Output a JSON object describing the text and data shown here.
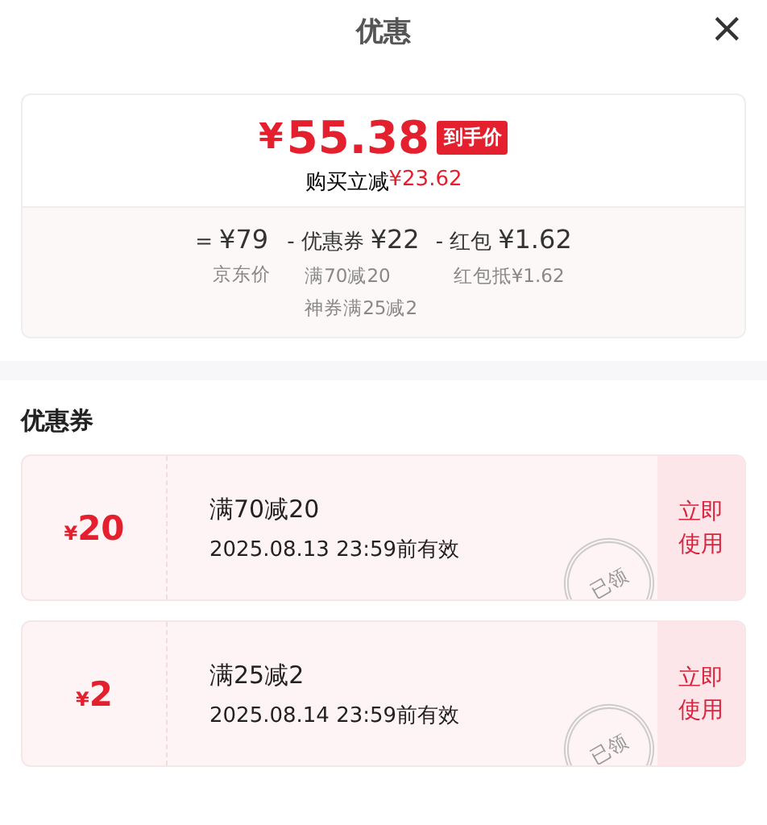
{
  "header": {
    "title": "优惠",
    "close": "×"
  },
  "summary": {
    "currency": "¥",
    "price": "55.38",
    "badge": "到手价",
    "saving_label": "购买立减",
    "saving_amount": "¥23.62",
    "breakdown": [
      {
        "operator": "=",
        "amount": "¥79",
        "notes": [
          "京东价"
        ]
      },
      {
        "operator": "-",
        "label": "优惠券",
        "amount": "¥22",
        "notes": [
          "满70减20",
          "神券满25减2"
        ]
      },
      {
        "operator": "-",
        "label": "红包",
        "amount": "¥1.62",
        "notes": [
          "红包抵¥1.62"
        ]
      }
    ]
  },
  "coupons_section": {
    "title": "优惠券",
    "coupons": [
      {
        "currency": "¥",
        "value": "20",
        "condition": "满70减20",
        "validity": "2025.08.13 23:59前有效",
        "claimed": true,
        "stamp": "已领",
        "action": "立即使用"
      },
      {
        "currency": "¥",
        "value": "2",
        "condition": "满25减2",
        "validity": "2025.08.14 23:59前有效",
        "claimed": true,
        "stamp": "已领",
        "action": "立即使用"
      }
    ]
  }
}
